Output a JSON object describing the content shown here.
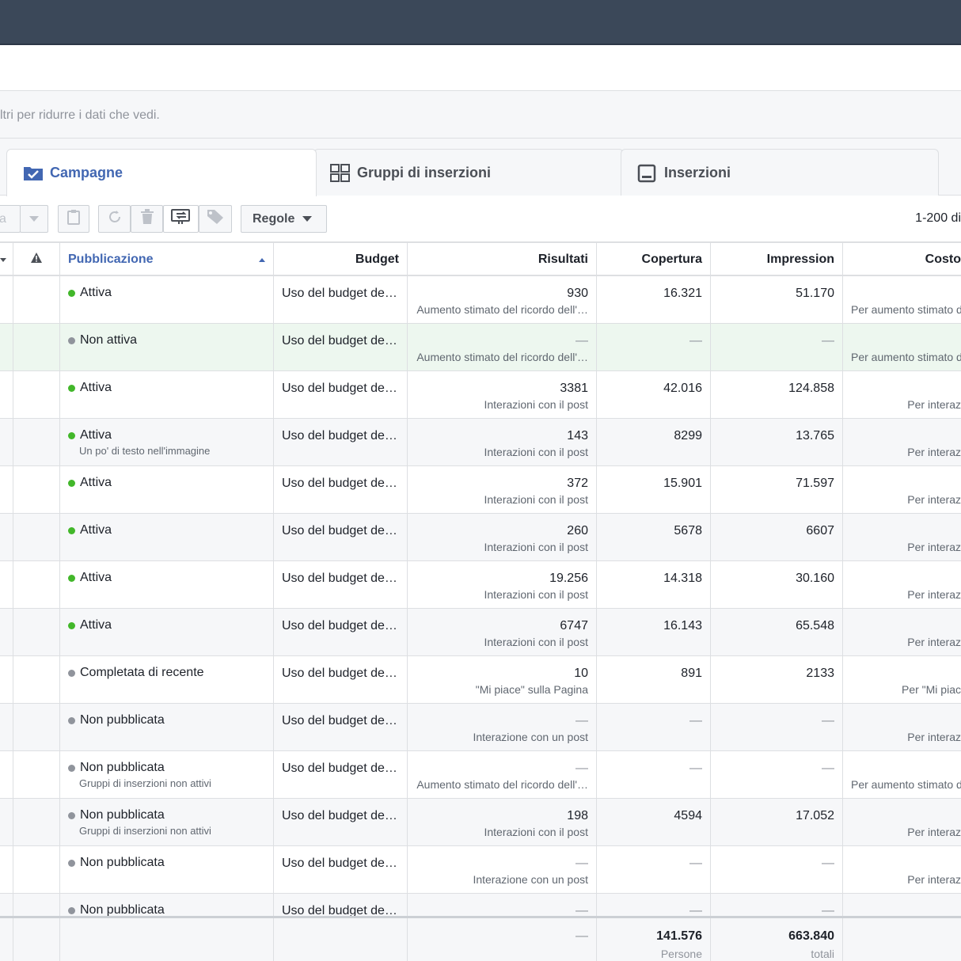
{
  "filter": {
    "text": "ltri per ridurre i dati che vedi."
  },
  "tabs": [
    {
      "label": "Campagne",
      "icon": "folder-check-icon",
      "active": true
    },
    {
      "label": "Gruppi di inserzioni",
      "icon": "grid-icon",
      "active": false
    },
    {
      "label": "Inserzioni",
      "icon": "ad-icon",
      "active": false
    }
  ],
  "toolbar": {
    "partial_label": "a",
    "rules_label": "Regole",
    "pager": "1-200 di"
  },
  "columns": {
    "publication": "Pubblicazione",
    "budget": "Budget",
    "results": "Risultati",
    "reach": "Copertura",
    "impressions": "Impression",
    "cost": "Costo"
  },
  "rows": [
    {
      "status": "Attiva",
      "status_color": "green",
      "status_sub": "",
      "budget": "Uso del budget de…",
      "results": "930",
      "results_sub": "Aumento stimato del ricordo dell'…",
      "reach": "16.321",
      "impressions": "51.170",
      "cost_sub": "Per aumento stimato d"
    },
    {
      "status": "Non attiva",
      "status_color": "grey",
      "status_sub": "",
      "budget": "Uso del budget de…",
      "results": "—",
      "results_sub": "Aumento stimato del ricordo dell'…",
      "reach": "—",
      "impressions": "—",
      "cost_sub": "Per aumento stimato d"
    },
    {
      "status": "Attiva",
      "status_color": "green",
      "status_sub": "",
      "budget": "Uso del budget de…",
      "results": "3381",
      "results_sub": "Interazioni con il post",
      "reach": "42.016",
      "impressions": "124.858",
      "cost_sub": "Per interaz"
    },
    {
      "status": "Attiva",
      "status_color": "green",
      "status_sub": "Un po' di testo nell'immagine",
      "budget": "Uso del budget de…",
      "results": "143",
      "results_sub": "Interazioni con il post",
      "reach": "8299",
      "impressions": "13.765",
      "cost_sub": "Per interaz"
    },
    {
      "status": "Attiva",
      "status_color": "green",
      "status_sub": "",
      "budget": "Uso del budget de…",
      "results": "372",
      "results_sub": "Interazioni con il post",
      "reach": "15.901",
      "impressions": "71.597",
      "cost_sub": "Per interaz"
    },
    {
      "status": "Attiva",
      "status_color": "green",
      "status_sub": "",
      "budget": "Uso del budget de…",
      "results": "260",
      "results_sub": "Interazioni con il post",
      "reach": "5678",
      "impressions": "6607",
      "cost_sub": "Per interaz"
    },
    {
      "status": "Attiva",
      "status_color": "green",
      "status_sub": "",
      "budget": "Uso del budget de…",
      "results": "19.256",
      "results_sub": "Interazioni con il post",
      "reach": "14.318",
      "impressions": "30.160",
      "cost_sub": "Per interaz"
    },
    {
      "status": "Attiva",
      "status_color": "green",
      "status_sub": "",
      "budget": "Uso del budget de…",
      "results": "6747",
      "results_sub": "Interazioni con il post",
      "reach": "16.143",
      "impressions": "65.548",
      "cost_sub": "Per interaz"
    },
    {
      "status": "Completata di recente",
      "status_color": "grey",
      "status_sub": "",
      "budget": "Uso del budget de…",
      "results": "10",
      "results_sub": "\"Mi piace\" sulla Pagina",
      "reach": "891",
      "impressions": "2133",
      "cost_sub": "Per \"Mi piac"
    },
    {
      "status": "Non pubblicata",
      "status_color": "grey",
      "status_sub": "",
      "budget": "Uso del budget de…",
      "results": "—",
      "results_sub": "Interazione con un post",
      "reach": "—",
      "impressions": "—",
      "cost_sub": "Per interaz"
    },
    {
      "status": "Non pubblicata",
      "status_color": "grey",
      "status_sub": "Gruppi di inserzioni non attivi",
      "budget": "Uso del budget de…",
      "results": "—",
      "results_sub": "Aumento stimato del ricordo dell'…",
      "reach": "—",
      "impressions": "—",
      "cost_sub": "Per aumento stimato d"
    },
    {
      "status": "Non pubblicata",
      "status_color": "grey",
      "status_sub": "Gruppi di inserzioni non attivi",
      "budget": "Uso del budget de…",
      "results": "198",
      "results_sub": "Interazioni con il post",
      "reach": "4594",
      "impressions": "17.052",
      "cost_sub": "Per interaz"
    },
    {
      "status": "Non pubblicata",
      "status_color": "grey",
      "status_sub": "",
      "budget": "Uso del budget de…",
      "results": "—",
      "results_sub": "Interazione con un post",
      "reach": "—",
      "impressions": "—",
      "cost_sub": "Per interaz"
    },
    {
      "status": "Non pubblicata",
      "status_color": "grey",
      "status_sub": "",
      "budget": "Uso del budget de…",
      "results": "—",
      "results_sub": "",
      "reach": "—",
      "impressions": "—",
      "cost_sub": ""
    }
  ],
  "totals": {
    "results": "—",
    "reach": "141.576",
    "reach_sub": "Persone",
    "impressions": "663.840",
    "impressions_sub": "totali"
  }
}
